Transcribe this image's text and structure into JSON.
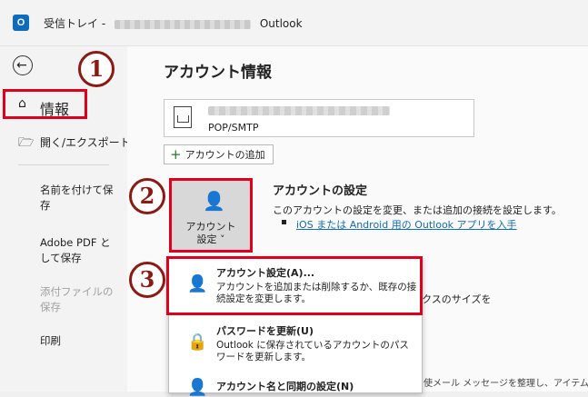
{
  "window": {
    "app_icon": "O",
    "title_prefix": "受信トレイ -",
    "title_suffix": "Outlook"
  },
  "sidebar": {
    "back_icon": "←",
    "items": [
      {
        "icon": "home-icon",
        "label": "情報"
      },
      {
        "icon": "folder-open-icon",
        "label": "開く/エクスポート"
      },
      {
        "label": "名前を付けて保存"
      },
      {
        "label": "Adobe PDF として保存"
      },
      {
        "label": "添付ファイルの保存"
      },
      {
        "label": "印刷"
      }
    ]
  },
  "main": {
    "heading": "アカウント情報",
    "account_type": "POP/SMTP",
    "add_account_label": "アカウントの追加",
    "settings_tile_label_1": "アカウント",
    "settings_tile_label_2": "設定 ˅",
    "section_title": "アカウントの設定",
    "section_desc": "このアカウントの設定を変更、または追加の接続を設定します。",
    "section_link": "iOS または Android 用の Outlook アプリを入手",
    "behind_text": "理を利用して、メールボックスのサイズを",
    "behind_text_2": "使メール メッセージを整理し、アイテムを"
  },
  "dropdown": {
    "items": [
      {
        "title": "アカウント設定(A)...",
        "desc": "アカウントを追加または削除するか、既存の接続設定を変更します。"
      },
      {
        "title": "パスワードを更新(U)",
        "desc": "Outlook に保存されているアカウントのパスワードを更新します。"
      },
      {
        "title": "アカウント名と同期の設定(N)",
        "desc": ""
      }
    ]
  },
  "annotations": {
    "badge_1": "1",
    "badge_2": "2",
    "badge_3": "3"
  },
  "colors": {
    "highlight_red": "#e0001b",
    "badge_dark_red": "#8b1a12",
    "link_blue": "#0f6cbd"
  }
}
